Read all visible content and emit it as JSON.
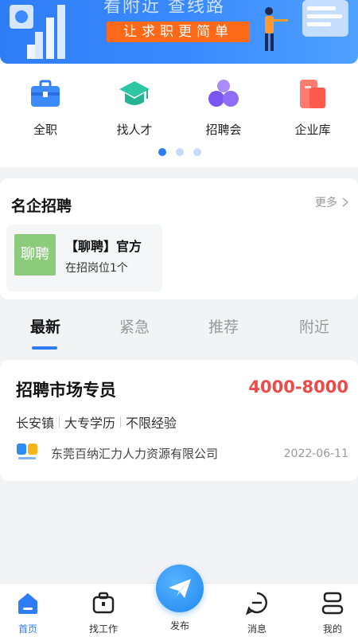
{
  "banner": {
    "title_partial": "看附近  查线路",
    "slogan": "让求职更简单"
  },
  "categories": [
    {
      "label": "全职",
      "icon": "briefcase-icon"
    },
    {
      "label": "找人才",
      "icon": "graduation-cap-icon"
    },
    {
      "label": "招聘会",
      "icon": "people-group-icon"
    },
    {
      "label": "企业库",
      "icon": "company-library-icon"
    }
  ],
  "pager": {
    "count": 3,
    "active_index": 0
  },
  "famous": {
    "title": "名企招聘",
    "more_label": "更多",
    "company": {
      "logo_text": "聊聘",
      "name": "【聊聘】官方",
      "positions": "在招岗位1个"
    }
  },
  "tabs": [
    {
      "label": "最新",
      "active": true
    },
    {
      "label": "紧急",
      "active": false
    },
    {
      "label": "推荐",
      "active": false
    },
    {
      "label": "附近",
      "active": false
    }
  ],
  "job": {
    "title": "招聘市场专员",
    "salary": "4000-8000",
    "tags": [
      "长安镇",
      "大专学历",
      "不限经验"
    ],
    "company": "东莞百纳汇力人力资源有限公司",
    "date": "2022-06-11"
  },
  "bottom_nav": {
    "items": [
      {
        "label": "首页",
        "icon": "home-icon",
        "active": true
      },
      {
        "label": "找工作",
        "icon": "job-bag-icon",
        "active": false
      },
      {
        "label": "发布",
        "icon": "paper-plane-icon",
        "active": false
      },
      {
        "label": "消息",
        "icon": "message-icon",
        "active": false
      },
      {
        "label": "我的",
        "icon": "profile-icon",
        "active": false
      }
    ]
  },
  "colors": {
    "accent": "#2f7df6",
    "salary": "#ee4a4a",
    "slogan_bg": "#ff6a1a",
    "company_logo_bg": "#8dcb7c"
  }
}
